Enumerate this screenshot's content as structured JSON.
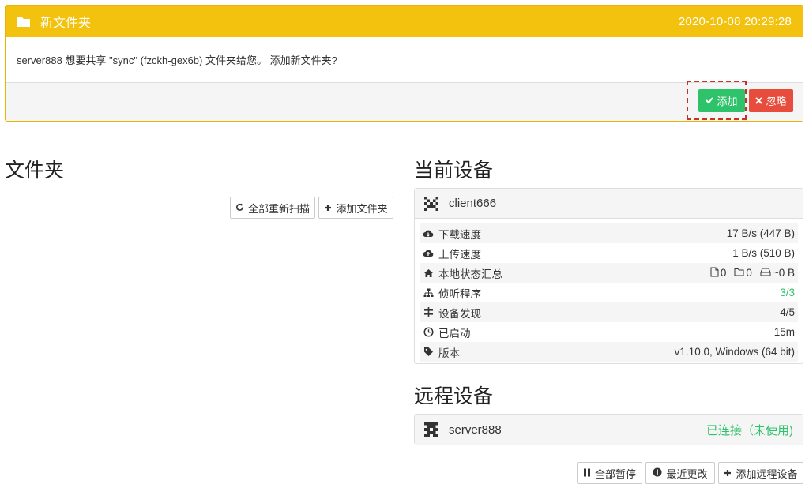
{
  "notification": {
    "title": "新文件夹",
    "timestamp": "2020-10-08 20:29:28",
    "message": "server888 想要共享 \"sync\" (fzckh-gex6b) 文件夹给您。 添加新文件夹?",
    "add_label": "添加",
    "ignore_label": "忽略",
    "header_color": "#f2c20f"
  },
  "folders": {
    "heading": "文件夹",
    "rescan_all_label": "全部重新扫描",
    "add_folder_label": "添加文件夹"
  },
  "this_device": {
    "heading": "当前设备",
    "name": "client666",
    "rows": [
      {
        "icon": "cloud-download-icon",
        "label": "下载速度",
        "value": "17 B/s (447 B)"
      },
      {
        "icon": "cloud-upload-icon",
        "label": "上传速度",
        "value": "1 B/s (510 B)"
      },
      {
        "icon": "home-icon",
        "label": "本地状态汇总",
        "files": "0",
        "dirs": "0",
        "size": "~0 B"
      },
      {
        "icon": "sitemap-icon",
        "label": "侦听程序",
        "value": "3/3"
      },
      {
        "icon": "signpost-icon",
        "label": "设备发现",
        "value": "4/5"
      },
      {
        "icon": "clock-icon",
        "label": "已启动",
        "value": "15m"
      },
      {
        "icon": "tag-icon",
        "label": "版本",
        "value": "v1.10.0, Windows (64 bit)"
      }
    ]
  },
  "remote_devices": {
    "heading": "远程设备",
    "items": [
      {
        "name": "server888",
        "status": "已连接（未使用)",
        "status_color": "#2ec26a"
      }
    ],
    "pause_all_label": "全部暂停",
    "recent_changes_label": "最近更改",
    "add_remote_label": "添加远程设备"
  }
}
